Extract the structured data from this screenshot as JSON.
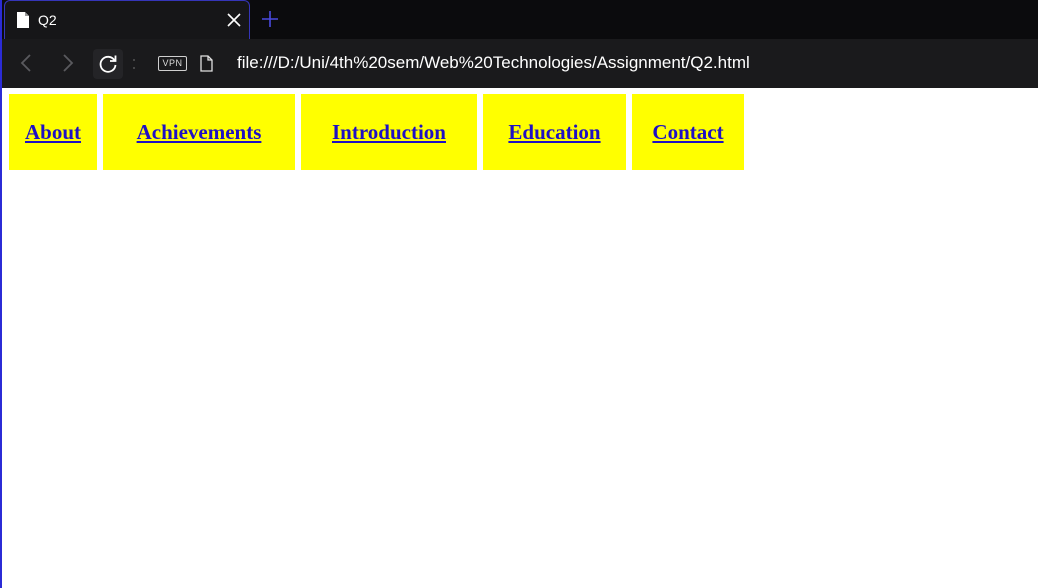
{
  "tab": {
    "title": "Q2"
  },
  "toolbar": {
    "vpn_label": "VPN",
    "url": "file:///D:/Uni/4th%20sem/Web%20Technologies/Assignment/Q2.html"
  },
  "nav": {
    "items": [
      {
        "label": "About"
      },
      {
        "label": "Achievements"
      },
      {
        "label": "Introduction"
      },
      {
        "label": "Education"
      },
      {
        "label": "Contact"
      }
    ]
  },
  "colors": {
    "nav_background": "#ffff00",
    "link": "#1f10c4",
    "tab_accent": "#3535b8",
    "chrome_background": "#0b0b0d"
  }
}
